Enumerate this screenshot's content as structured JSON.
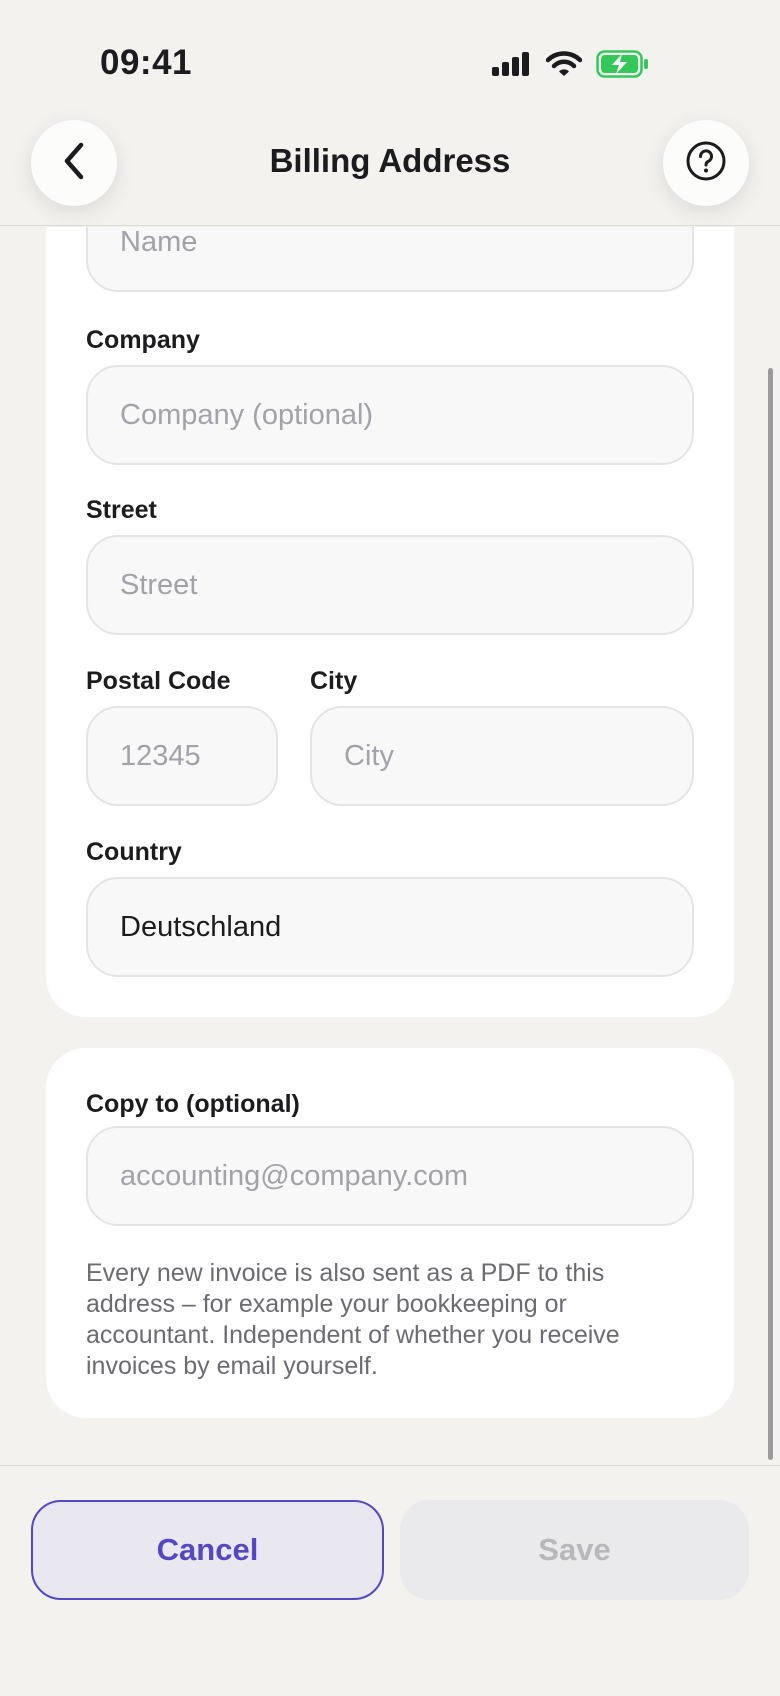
{
  "status_bar": {
    "time": "09:41"
  },
  "nav": {
    "title": "Billing Address"
  },
  "address_form": {
    "name": {
      "placeholder": "Name"
    },
    "company": {
      "label": "Company",
      "placeholder": "Company (optional)"
    },
    "street": {
      "label": "Street",
      "placeholder": "Street"
    },
    "postal_code": {
      "label": "Postal Code",
      "placeholder": "12345"
    },
    "city": {
      "label": "City",
      "placeholder": "City"
    },
    "country": {
      "label": "Country",
      "value": "Deutschland"
    }
  },
  "copy_to": {
    "label": "Copy to (optional)",
    "placeholder": "accounting@company.com",
    "helper": "Every new invoice is also sent as a PDF to this address – for example your bookkeeping or accountant. Independent of whether you receive invoices by email yourself."
  },
  "footer": {
    "cancel_label": "Cancel",
    "save_label": "Save"
  },
  "colors": {
    "accent": "#5447c4",
    "background": "#f3f2ef",
    "battery": "#34c759"
  }
}
